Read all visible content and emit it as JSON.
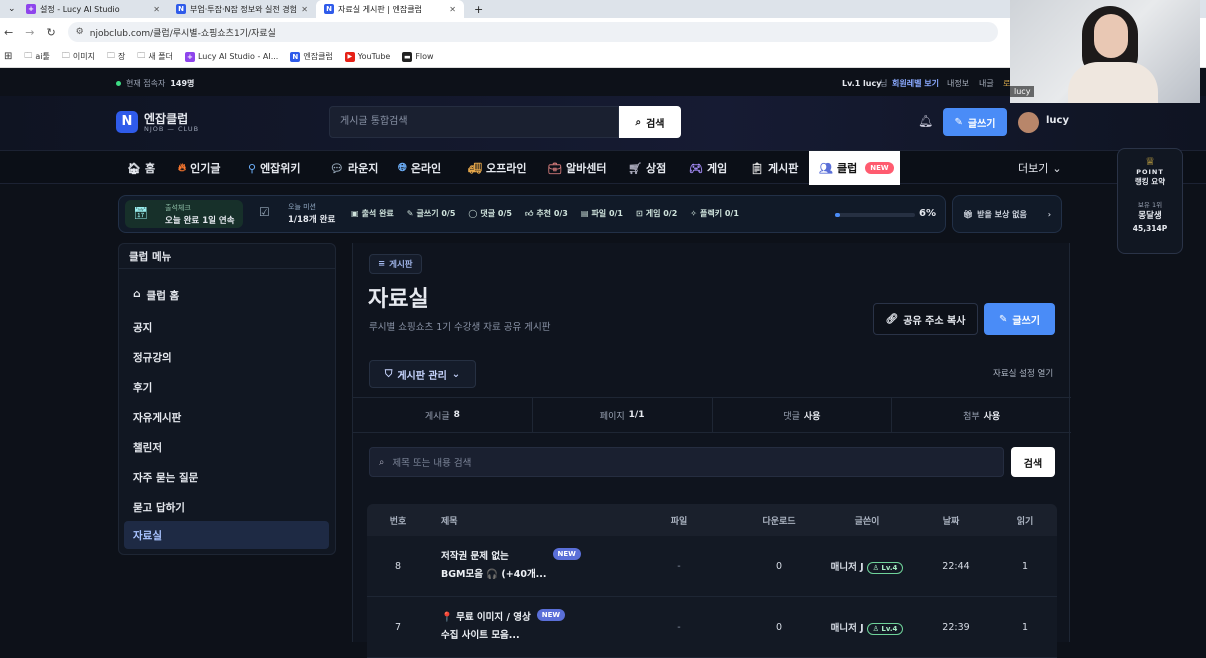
{
  "browser": {
    "tabs": [
      {
        "title": "설정 - Lucy AI Studio",
        "fav_color": "#8e44ec",
        "fav_glyph": "+"
      },
      {
        "title": "부업·투잡·N잡 정보와 실전 경험",
        "fav_color": "#2f5bea",
        "fav_glyph": "N"
      },
      {
        "title": "자료실 게시판 | 엔잡클럽",
        "fav_color": "#2f5bea",
        "fav_glyph": "N"
      }
    ],
    "new_tab": "+",
    "url": "njobclub.com/클럽/루시별-쇼핑쇼츠1기/자료실",
    "bookmarks": [
      "ai툴",
      "이미지",
      "장",
      "새 폴더",
      "Lucy AI Studio - AI...",
      "엔잡클럽",
      "YouTube",
      "Flow"
    ]
  },
  "topstrip": {
    "online_label": "현재 접속자",
    "online_count": "149명",
    "level": "Lv.1 lucy",
    "level_suffix": "님",
    "view_level": "회원레벨 보기",
    "myinfo": "내정보",
    "mypage": "내글",
    "logout": "로"
  },
  "header": {
    "logo_title": "엔잡클럽",
    "logo_sub": "NJOB — CLUB",
    "search_placeholder": "게시글 통합검색",
    "search_button": "검색",
    "write_button": "글쓰기",
    "user": "lucy"
  },
  "nav": {
    "items": [
      "홈",
      "인기글",
      "엔잡위키",
      "라운지",
      "온라인",
      "오프라인",
      "알바센터",
      "상점",
      "게임",
      "게시판",
      "클럽"
    ],
    "new_badge": "NEW",
    "more": "더보기"
  },
  "mission": {
    "attend_label": "출석체크",
    "attend_value": "오늘 완료 1일 연속",
    "today_label": "오늘 미션",
    "today_value": "1/18개 완료",
    "chips": [
      "출석 완료",
      "글쓰기 0/5",
      "댓글 0/5",
      "추천 0/3",
      "파일 0/1",
      "게임 0/2",
      "플렉키 0/1"
    ],
    "percent": "6%",
    "progress": 0.06,
    "reward": "받을 보상 없음"
  },
  "point": {
    "label1": "POINT",
    "label2": "랭킹 요약",
    "rank": "보유 1위",
    "name": "몽달생",
    "points": "45,314P"
  },
  "sidebar": {
    "title": "클럽 메뉴",
    "items": [
      "클럽 홈",
      "공지",
      "정규강의",
      "후기",
      "자유게시판",
      "챌린저",
      "자주 묻는 질문",
      "묻고 답하기",
      "자료실"
    ]
  },
  "main": {
    "badge": "게시판",
    "title": "자료실",
    "desc": "루시별 쇼핑쇼츠 1기 수강생 자료 공유 게시판",
    "share_button": "공유 주소 복사",
    "write_button": "글쓰기",
    "manage_button": "게시판 관리",
    "settings_link": "자료실 설정 열기",
    "stats": [
      {
        "label": "게시글",
        "value": "8"
      },
      {
        "label": "페이지",
        "value": "1/1"
      },
      {
        "label": "댓글",
        "value": "사용"
      },
      {
        "label": "첨부",
        "value": "사용"
      }
    ],
    "search_placeholder": "제목 또는 내용 검색",
    "search_button": "검색",
    "columns": [
      "번호",
      "제목",
      "파일",
      "다운로드",
      "글쓴이",
      "날짜",
      "읽기"
    ],
    "rows": [
      {
        "num": "8",
        "title1": "저작권 문제 없는",
        "title2": "BGM모음 🎧 (+40개...",
        "badge": "NEW",
        "file": "-",
        "downloads": "0",
        "author": "매니저 J",
        "level": "Lv.4",
        "date": "22:44",
        "reads": "1"
      },
      {
        "num": "7",
        "title1": "📍 무료 이미지 / 영상",
        "title2": "수집 사이트 모음...",
        "badge": "NEW",
        "file": "-",
        "downloads": "0",
        "author": "매니저 J",
        "level": "Lv.4",
        "date": "22:39",
        "reads": "1"
      }
    ]
  },
  "webcam": {
    "name": "lucy"
  }
}
